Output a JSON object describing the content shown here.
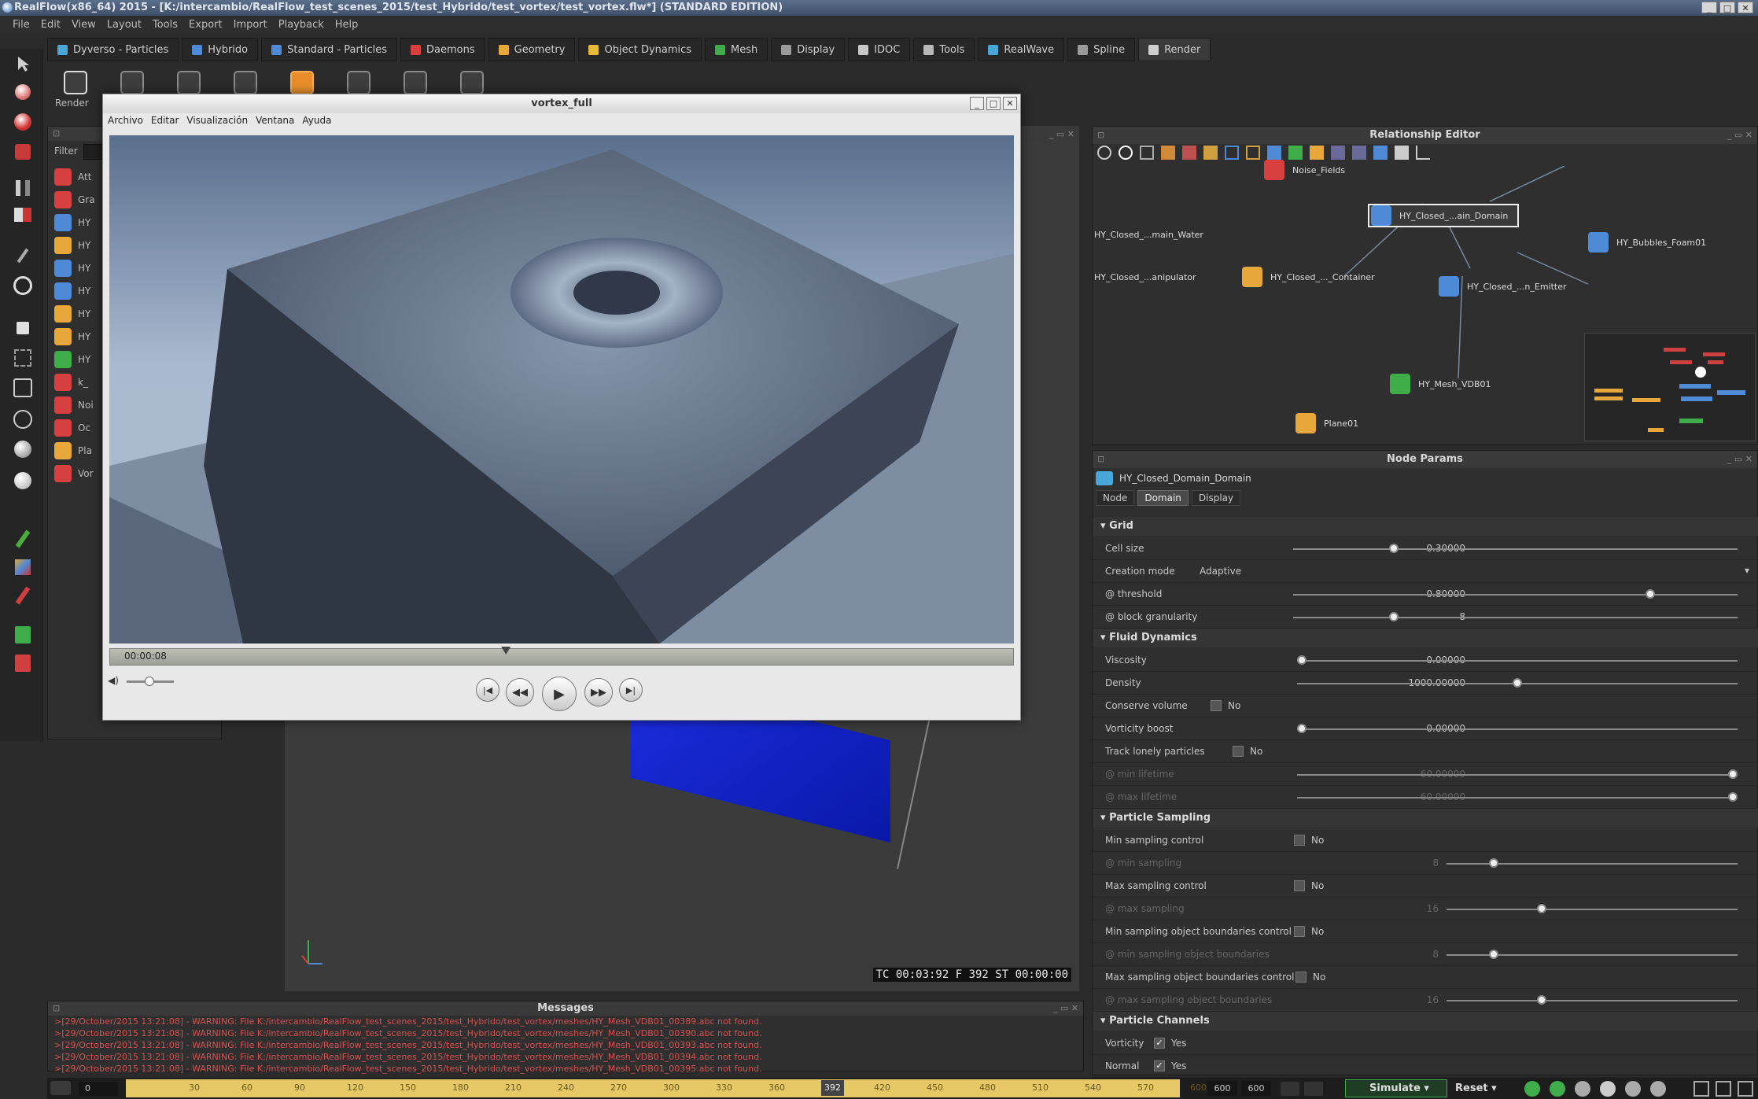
{
  "window": {
    "title": "RealFlow(x86_64) 2015 - [K:/intercambio/RealFlow_test_scenes_2015/test_Hybrido/test_vortex/test_vortex.flw*] (STANDARD EDITION)",
    "controls": [
      "_",
      "□",
      "✕"
    ]
  },
  "menu": [
    "File",
    "Edit",
    "View",
    "Layout",
    "Tools",
    "Export",
    "Import",
    "Playback",
    "Help"
  ],
  "tabs": [
    {
      "label": "Dyverso - Particles",
      "color": "#49a7d8"
    },
    {
      "label": "Hybrido",
      "color": "#4f8ad6"
    },
    {
      "label": "Standard - Particles",
      "color": "#4f8ad6"
    },
    {
      "label": "Daemons",
      "color": "#d84040"
    },
    {
      "label": "Geometry",
      "color": "#e7a73a"
    },
    {
      "label": "Object Dynamics",
      "color": "#e7b93a"
    },
    {
      "label": "Mesh",
      "color": "#3fae4a"
    },
    {
      "label": "Display",
      "color": "#9a9a9a"
    },
    {
      "label": "IDOC",
      "color": "#c7c7c7"
    },
    {
      "label": "Tools",
      "color": "#b8b8b8"
    },
    {
      "label": "RealWave",
      "color": "#49a7d8"
    },
    {
      "label": "Spline",
      "color": "#9a9a9a"
    },
    {
      "label": "Render",
      "color": "#cfcfcf"
    }
  ],
  "toolbar": {
    "render_label": "Render"
  },
  "outliner": {
    "filter_label": "Filter",
    "items": [
      {
        "label": "Att",
        "color": "#d84040"
      },
      {
        "label": "Gra",
        "color": "#d84040"
      },
      {
        "label": "HY",
        "color": "#4f8ad6"
      },
      {
        "label": "HY",
        "color": "#e7a73a"
      },
      {
        "label": "HY",
        "color": "#4f8ad6"
      },
      {
        "label": "HY",
        "color": "#4f8ad6"
      },
      {
        "label": "HY",
        "color": "#e7a73a"
      },
      {
        "label": "HY",
        "color": "#e7a73a"
      },
      {
        "label": "HY",
        "color": "#3fae4a"
      },
      {
        "label": "k_",
        "color": "#d84040"
      },
      {
        "label": "Noi",
        "color": "#d84040"
      },
      {
        "label": "Oc",
        "color": "#d84040"
      },
      {
        "label": "Pla",
        "color": "#e7a73a"
      },
      {
        "label": "Vor",
        "color": "#d84040"
      }
    ]
  },
  "viewport": {
    "status": "TC 00:03:92   F 392   ST 00:00:00"
  },
  "relationship_editor": {
    "title": "Relationship Editor",
    "nodes": [
      {
        "label": "Noise_Fields",
        "color": "#d84040"
      },
      {
        "label": "HY_Closed_...ain_Domain",
        "color": "#4f8ad6"
      },
      {
        "label": "HY_Closed_...main_Water",
        "color": ""
      },
      {
        "label": "HY_Closed_...anipulator",
        "color": ""
      },
      {
        "label": "HY_Closed_..._Container",
        "color": "#e7a73a"
      },
      {
        "label": "HY_Closed_...n_Emitter",
        "color": "#4f8ad6"
      },
      {
        "label": "HY_Bubbles_Foam01",
        "color": "#4f8ad6"
      },
      {
        "label": "HY_Mesh_VDB01",
        "color": "#3fae4a"
      },
      {
        "label": "Plane01",
        "color": "#e7a73a"
      }
    ]
  },
  "node_params": {
    "title": "Node Params",
    "node_name": "HY_Closed_Domain_Domain",
    "tabs": [
      "Node",
      "Domain",
      "Display"
    ],
    "active_tab": "Domain",
    "sections": {
      "grid": "Grid",
      "fluid": "Fluid Dynamics",
      "sampling": "Particle Sampling",
      "channels": "Particle Channels"
    },
    "params": {
      "cell_size": {
        "label": "Cell size",
        "value": "0.30000",
        "level": 0.22
      },
      "creation_mode": {
        "label": "Creation mode",
        "value": "Adaptive"
      },
      "threshold": {
        "label": "@ threshold",
        "value": "0.80000",
        "level": 0.81
      },
      "block_granularity": {
        "label": "@ block granularity",
        "value": "8",
        "level": 0.22
      },
      "viscosity": {
        "label": "Viscosity",
        "value": "0.00000",
        "level": 0.0
      },
      "density": {
        "label": "Density",
        "value": "1000.00000",
        "level": 0.5
      },
      "conserve_volume": {
        "label": "Conserve volume",
        "value": "No"
      },
      "vorticity_boost": {
        "label": "Vorticity boost",
        "value": "0.00000",
        "level": 0.0
      },
      "track_lonely": {
        "label": "Track lonely particles",
        "value": "No"
      },
      "min_lifetime": {
        "label": "@ min lifetime",
        "value": "60.00000",
        "level": 1.0
      },
      "max_lifetime": {
        "label": "@ max lifetime",
        "value": "60.00000",
        "level": 1.0
      },
      "min_sampling_control": {
        "label": "Min sampling control",
        "value": "No"
      },
      "min_sampling": {
        "label": "@ min sampling",
        "value": "8",
        "level": 0.15
      },
      "max_sampling_control": {
        "label": "Max sampling control",
        "value": "No"
      },
      "max_sampling": {
        "label": "@ max sampling",
        "value": "16",
        "level": 0.32
      },
      "min_boundaries_control": {
        "label": "Min sampling object boundaries control",
        "value": "No"
      },
      "min_boundaries": {
        "label": "@ min sampling object boundaries",
        "value": "8",
        "level": 0.15
      },
      "max_boundaries_control": {
        "label": "Max sampling object boundaries control",
        "value": "No"
      },
      "max_boundaries": {
        "label": "@ max sampling object boundaries",
        "value": "16",
        "level": 0.32
      },
      "vorticity": {
        "label": "Vorticity",
        "value": "Yes"
      },
      "normal": {
        "label": "Normal",
        "value": "Yes"
      }
    }
  },
  "messages": {
    "title": "Messages",
    "lines": [
      ">[29/October/2015 13:21:08] - WARNING: File K:/intercambio/RealFlow_test_scenes_2015/test_Hybrido/test_vortex/meshes/HY_Mesh_VDB01_00389.abc not found.",
      ">[29/October/2015 13:21:08] - WARNING: File K:/intercambio/RealFlow_test_scenes_2015/test_Hybrido/test_vortex/meshes/HY_Mesh_VDB01_00390.abc not found.",
      ">[29/October/2015 13:21:08] - WARNING: File K:/intercambio/RealFlow_test_scenes_2015/test_Hybrido/test_vortex/meshes/HY_Mesh_VDB01_00393.abc not found.",
      ">[29/October/2015 13:21:08] - WARNING: File K:/intercambio/RealFlow_test_scenes_2015/test_Hybrido/test_vortex/meshes/HY_Mesh_VDB01_00394.abc not found.",
      ">[29/October/2015 13:21:08] - WARNING: File K:/intercambio/RealFlow_test_scenes_2015/test_Hybrido/test_vortex/meshes/HY_Mesh_VDB01_00395.abc not found."
    ]
  },
  "timeline": {
    "start": "0",
    "ticks": [
      "30",
      "60",
      "90",
      "120",
      "150",
      "180",
      "210",
      "240",
      "270",
      "300",
      "330",
      "360",
      "392",
      "420",
      "450",
      "480",
      "510",
      "540",
      "570",
      "600"
    ],
    "current_frame": "392",
    "end_a": "600",
    "end_b": "600",
    "simulate_label": "Simulate",
    "reset_label": "Reset"
  },
  "player": {
    "title": "vortex_full",
    "menu": [
      "Archivo",
      "Editar",
      "Visualización",
      "Ventana",
      "Ayuda"
    ],
    "time": "00:00:08",
    "progress": 0.44,
    "volume": 0.45
  }
}
